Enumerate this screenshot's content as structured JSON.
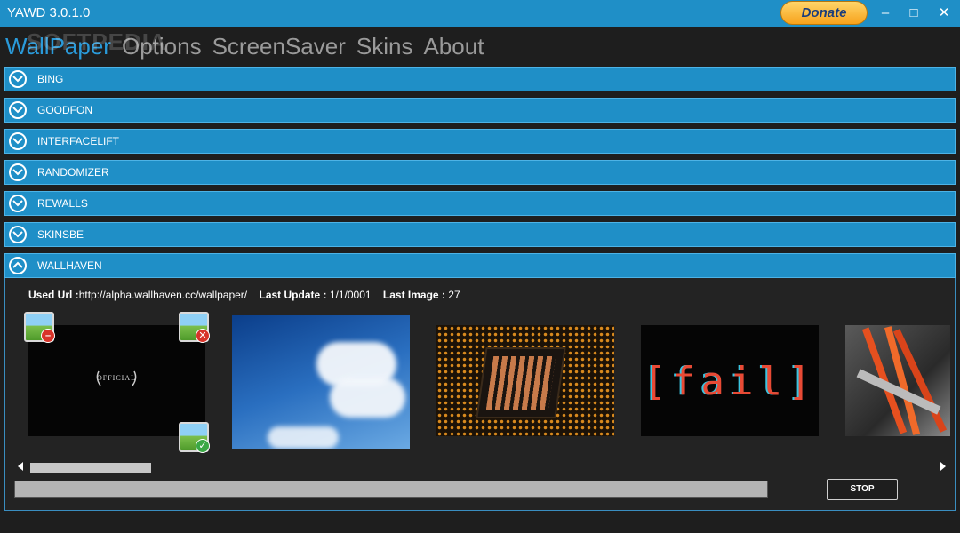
{
  "window": {
    "title": "YAWD 3.0.1.0",
    "donate": "Donate",
    "minimize": "–",
    "maximize": "□",
    "close": "✕"
  },
  "watermark": "SOFTPEDIA",
  "menu": {
    "items": [
      "WallPaper",
      "Options",
      "ScreenSaver",
      "Skins",
      "About"
    ],
    "active": "WallPaper"
  },
  "sources": [
    {
      "label": "BING",
      "expanded": false
    },
    {
      "label": "GOODFON",
      "expanded": false
    },
    {
      "label": "INTERFACELIFT",
      "expanded": false
    },
    {
      "label": "RANDOMIZER",
      "expanded": false
    },
    {
      "label": "REWALLS",
      "expanded": false
    },
    {
      "label": "SKINSBE",
      "expanded": false
    },
    {
      "label": "WALLHAVEN",
      "expanded": true
    }
  ],
  "wallhaven": {
    "used_url_label": "Used Url :",
    "used_url": "http://alpha.wallhaven.cc/wallpaper/",
    "last_update_label": "Last Update :",
    "last_update": "1/1/0001",
    "last_image_label": "Last Image :",
    "last_image": "27",
    "thumb1_text": "OFFICIAL",
    "thumb4_text": "[fail]",
    "stop_label": "STOP",
    "progress": 1.0
  },
  "icons": {
    "remove": "remove-badge-icon",
    "delete": "delete-badge-icon",
    "apply": "apply-badge-icon"
  },
  "colors": {
    "accent": "#1f8fc7",
    "active_menu": "#2a9ad9"
  }
}
